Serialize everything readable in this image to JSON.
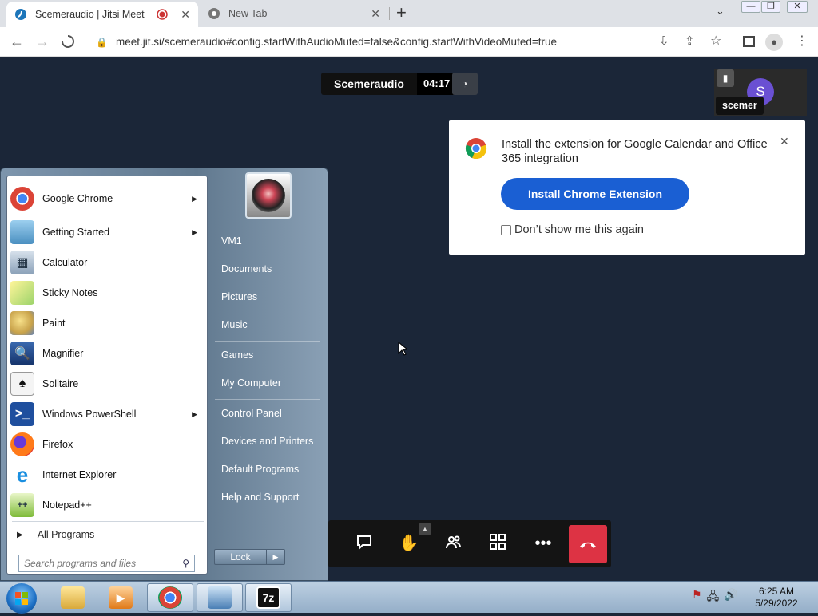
{
  "browser": {
    "tabs": [
      {
        "title": "Scemeraudio | Jitsi Meet",
        "active": true
      },
      {
        "title": "New Tab",
        "active": false
      }
    ],
    "url": "meet.jit.si/scemeraudio#config.startWithAudioMuted=false&config.startWithVideoMuted=true"
  },
  "meeting": {
    "name": "Scemeraudio",
    "timer": "04:17",
    "participant_initial": "S",
    "participant_name": "scemer"
  },
  "notification": {
    "message": "Install the extension for Google Calendar and Office 365 integration",
    "install_label": "Install Chrome Extension",
    "dont_show_label": "Don’t show me this again"
  },
  "start_menu": {
    "programs": [
      {
        "label": "Google Chrome",
        "icon": "chrome-icon",
        "has_submenu": true
      },
      {
        "label": "Getting Started",
        "icon": "getting-started-icon",
        "has_submenu": true
      },
      {
        "label": "Calculator",
        "icon": "calculator-icon",
        "has_submenu": false
      },
      {
        "label": "Sticky Notes",
        "icon": "sticky-notes-icon",
        "has_submenu": false
      },
      {
        "label": "Paint",
        "icon": "paint-icon",
        "has_submenu": false
      },
      {
        "label": "Magnifier",
        "icon": "magnifier-icon",
        "has_submenu": false
      },
      {
        "label": "Solitaire",
        "icon": "solitaire-icon",
        "has_submenu": false
      },
      {
        "label": "Windows PowerShell",
        "icon": "powershell-icon",
        "has_submenu": true
      },
      {
        "label": "Firefox",
        "icon": "firefox-icon",
        "has_submenu": false
      },
      {
        "label": "Internet Explorer",
        "icon": "internet-explorer-icon",
        "has_submenu": false
      },
      {
        "label": "Notepad++",
        "icon": "notepadpp-icon",
        "has_submenu": false
      }
    ],
    "all_programs_label": "All Programs",
    "search_placeholder": "Search programs and files",
    "right_items": [
      "VM1",
      "Documents",
      "Pictures",
      "Music",
      "Games",
      "My Computer",
      "Control Panel",
      "Devices and Printers",
      "Default Programs",
      "Help and Support"
    ],
    "lock_label": "Lock"
  },
  "taskbar": {
    "time": "6:25 AM",
    "date": "5/29/2022",
    "seven_zip_label": "7z"
  },
  "colors": {
    "meeting_bg": "#1b2638",
    "install_button": "#1a5fd3",
    "hangup": "#dd3344",
    "avatar": "#6a50d3"
  }
}
